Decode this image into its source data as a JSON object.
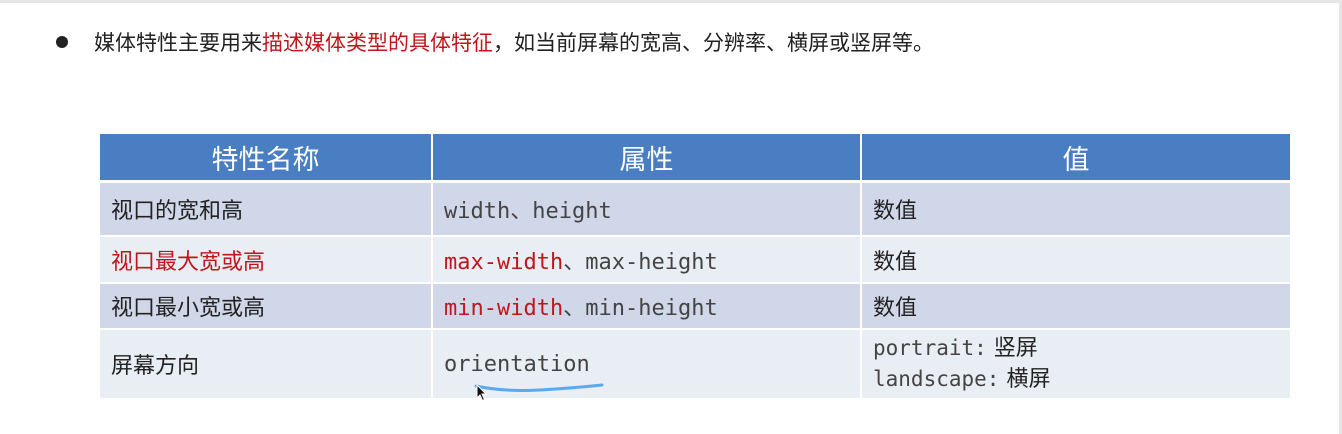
{
  "intro": {
    "part1": "媒体特性主要用来",
    "highlight": "描述媒体类型的具体特征",
    "part2": "，如当前屏幕的宽高、分辨率、横屏或竖屏等。"
  },
  "table": {
    "headers": [
      "特性名称",
      "属性",
      "值"
    ],
    "rows": [
      {
        "name": "视口的宽和高",
        "attr_a": "width",
        "attr_sep": "、",
        "attr_b": "height",
        "value": "数值"
      },
      {
        "name": "视口最大宽或高",
        "attr_a": "max-width",
        "attr_sep": "、",
        "attr_b": "max-height",
        "value": "数值"
      },
      {
        "name": "视口最小宽或高",
        "attr_a": "min-width",
        "attr_sep": "、",
        "attr_b": "min-height",
        "value": "数值"
      },
      {
        "name": "屏幕方向",
        "attr_a": "orientation",
        "value_lines": [
          {
            "key": "portrait:",
            "label": "竖屏"
          },
          {
            "key": "landscape:",
            "label": "横屏"
          }
        ]
      }
    ]
  },
  "colors": {
    "header_bg": "#4a7ec2",
    "row_dark": "#cfd7e8",
    "row_light": "#e9edf4",
    "highlight_red": "#c0161c",
    "annotation_blue": "#5aa9f2"
  }
}
